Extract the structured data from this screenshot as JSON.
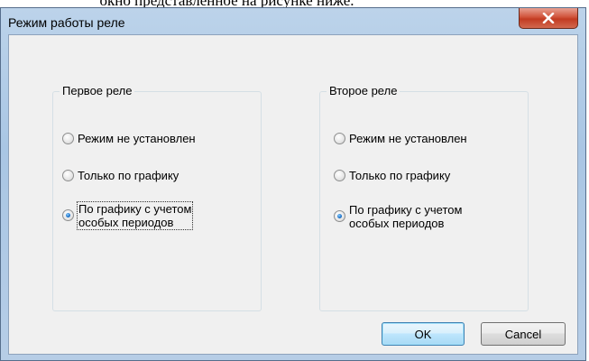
{
  "page_caption": "окно представленное на рисунке ниже.",
  "dialog": {
    "title": "Режим работы реле",
    "close_symbol": "x"
  },
  "groups": [
    {
      "title": "Первое реле",
      "options": [
        {
          "label": "Режим не установлен",
          "checked": false
        },
        {
          "label": "Только по графику",
          "checked": false
        },
        {
          "label_line1": "По графику с учетом",
          "label_line2": "особых периодов",
          "checked": true,
          "focused": true
        }
      ]
    },
    {
      "title": "Второе реле",
      "options": [
        {
          "label": "Режим не установлен",
          "checked": false
        },
        {
          "label": "Только по графику",
          "checked": false
        },
        {
          "label_line1": "По графику с учетом",
          "label_line2": "особых периодов",
          "checked": true,
          "focused": false
        }
      ]
    }
  ],
  "buttons": {
    "ok_label": "OK",
    "cancel_label": "Cancel"
  },
  "icons": {
    "close": "close-icon"
  },
  "colors": {
    "frame": "#b6cde6",
    "close_button": "#c23b22",
    "radio_selected": "#1a6fc7",
    "default_button_border": "#3c7fb1"
  }
}
